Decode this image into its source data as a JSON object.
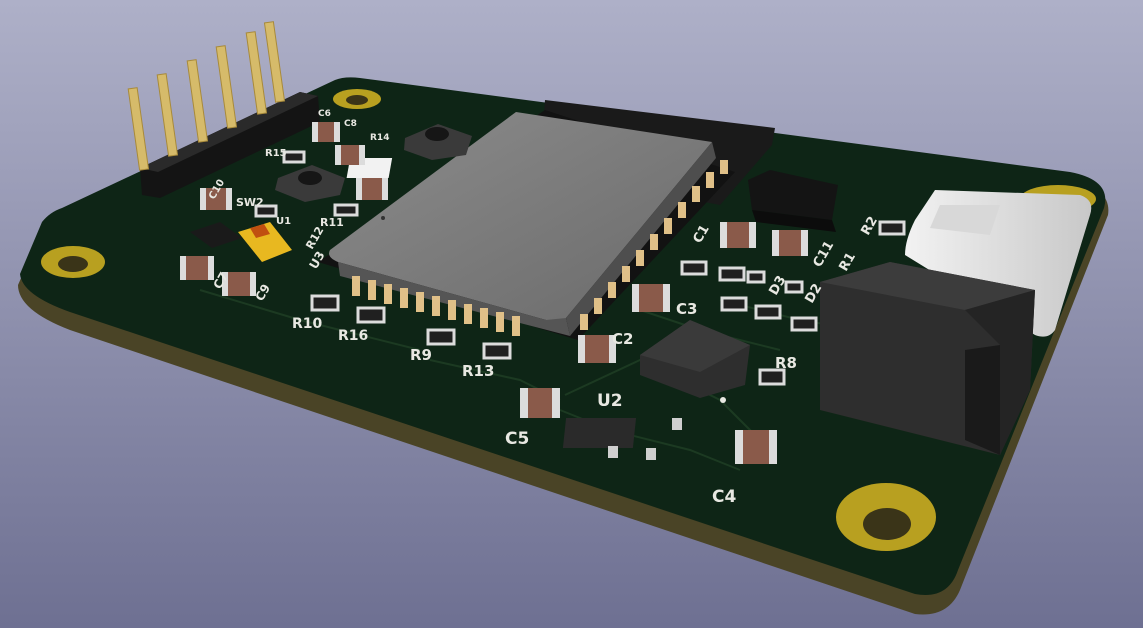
{
  "scene": {
    "background_top": "#aeb0c8",
    "background_bottom": "#6e7092",
    "board_color": "#0e2516",
    "board_edge_color": "#4a4426",
    "silkscreen_color": "#e8e8e2",
    "pad_gold": "#b8a020",
    "module_shield_color": "#7a7a7a"
  },
  "labels": {
    "c5": "C5",
    "c4": "C4",
    "u2": "U2",
    "c2": "C2",
    "c3": "C3",
    "r8": "R8",
    "r10": "R10",
    "r16": "R16",
    "r9": "R9",
    "r13": "R13",
    "c1": "C1",
    "c11": "C11",
    "d3": "D3",
    "d2": "D2",
    "r1": "R1",
    "r2": "R2",
    "u3": "U3",
    "r12": "R12",
    "sw2": "SW2",
    "c10": "C10",
    "c9": "C9",
    "c7": "C7",
    "r15": "R15",
    "c8": "C8",
    "r14": "R14",
    "r11": "R11",
    "u1": "U1",
    "c6": "C6"
  }
}
